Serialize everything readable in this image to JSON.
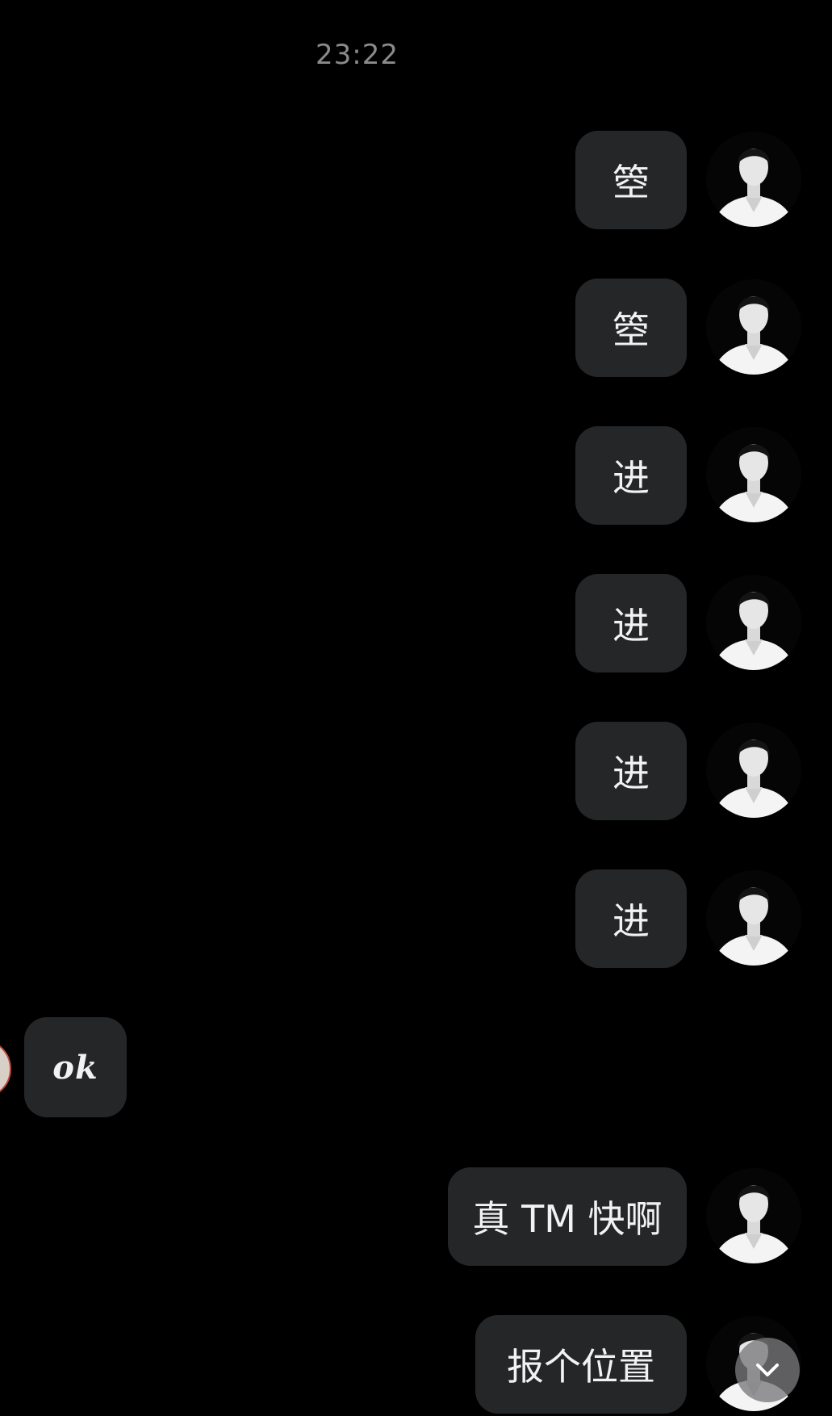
{
  "chat": {
    "timestamp": "23:22",
    "messages": [
      {
        "sender": "self",
        "text": "箜"
      },
      {
        "sender": "self",
        "text": "箜"
      },
      {
        "sender": "self",
        "text": "进"
      },
      {
        "sender": "self",
        "text": "进"
      },
      {
        "sender": "self",
        "text": "进"
      },
      {
        "sender": "self",
        "text": "进"
      },
      {
        "sender": "other",
        "text": "ok"
      },
      {
        "sender": "self",
        "text": "真 TM 快啊"
      },
      {
        "sender": "self",
        "text": "报个位置"
      }
    ]
  },
  "icons": {
    "avatar_self": "portrait-avatar",
    "avatar_other": "avatar",
    "scroll_down": "chevron-down-icon"
  },
  "colors": {
    "background": "#000000",
    "bubble": "#252628",
    "text": "#f2f2f2",
    "timestamp": "#8a8a8a"
  }
}
